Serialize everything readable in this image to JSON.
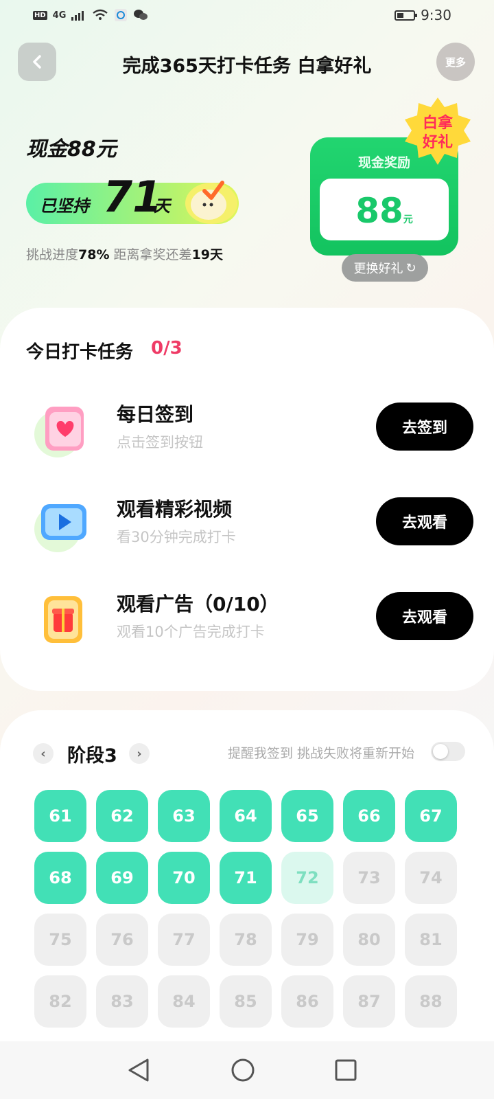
{
  "status_bar": {
    "hd": "HD",
    "network": "4G",
    "time": "9:30"
  },
  "header": {
    "back_label": "<",
    "title": "完成365天打卡任务 白拿好礼",
    "more_label": "更多"
  },
  "hero": {
    "cash_title": "现金88元",
    "persist_label": "已坚持",
    "persist_days": "71",
    "persist_unit": "天",
    "progress_prefix": "挑战进度",
    "progress_value": "78%",
    "progress_mid": "距离拿奖还差",
    "days_left": "19天"
  },
  "reward": {
    "title": "现金奖励",
    "amount": "88",
    "unit": "元",
    "badge_line1": "白拿",
    "badge_line2": "好礼",
    "change_label": "更换好礼",
    "refresh_glyph": "↻"
  },
  "tasks": {
    "title": "今日打卡任务",
    "count": "0/3",
    "items": [
      {
        "name": "每日签到",
        "desc": "点击签到按钮",
        "button": "去签到"
      },
      {
        "name": "观看精彩视频",
        "desc": "看30分钟完成打卡",
        "button": "去观看"
      },
      {
        "name": "观看广告（0/10）",
        "desc": "观看10个广告完成打卡",
        "button": "去观看"
      }
    ]
  },
  "stage": {
    "prev": "‹",
    "next": "›",
    "label": "阶段3",
    "remind": "提醒我签到 挑战失败将重新开始",
    "remind_enabled": false,
    "days": [
      "61",
      "62",
      "63",
      "64",
      "65",
      "66",
      "67",
      "68",
      "69",
      "70",
      "71",
      "72",
      "73",
      "74",
      "75",
      "76",
      "77",
      "78",
      "79",
      "80",
      "81",
      "82",
      "83",
      "84",
      "85",
      "86",
      "87",
      "88"
    ],
    "completed_through": "71",
    "today": "72"
  },
  "colors": {
    "done": "#42e0b6",
    "today": "#dbf8ee",
    "future": "#efefef",
    "accent_red": "#ef3b66",
    "reward_green": "#19c86a"
  },
  "icons": [
    "calendar-heart-icon",
    "video-play-icon",
    "gift-box-icon",
    "mascot-check-icon",
    "back-nav-icon",
    "home-nav-icon",
    "recents-nav-icon"
  ]
}
